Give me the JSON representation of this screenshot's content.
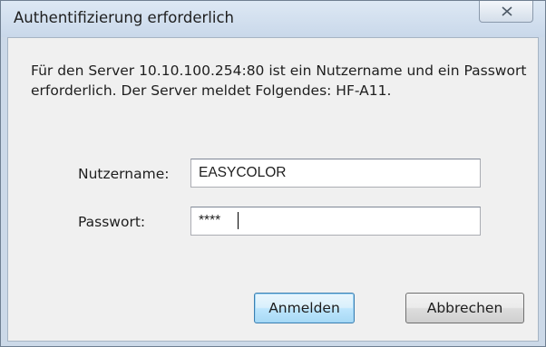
{
  "dialog": {
    "title": "Authentifizierung erforderlich",
    "message": "Für den Server 10.10.100.254:80 ist ein Nutzername und ein Passwort erforderlich. Der Server meldet Folgendes: HF-A11.",
    "username_label": "Nutzername:",
    "username_value": "EASYCOLOR",
    "password_label": "Passwort:",
    "password_value": "****",
    "login_button": "Anmelden",
    "cancel_button": "Abbrechen",
    "close_icon": "close-icon"
  }
}
